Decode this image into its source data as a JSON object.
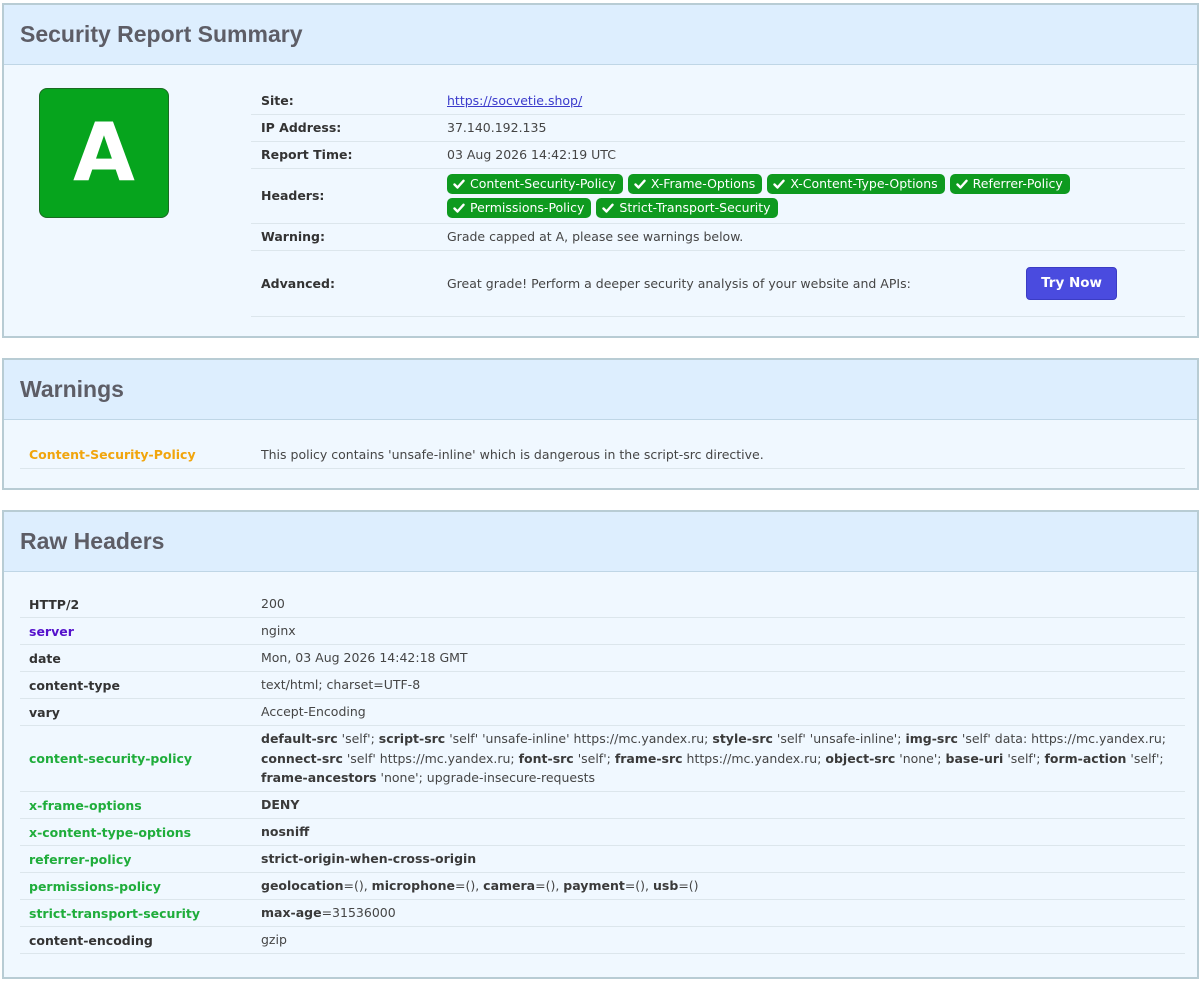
{
  "summary": {
    "title": "Security Report Summary",
    "grade": "A",
    "grade_color": "#06a41d",
    "rows": {
      "site_label": "Site:",
      "site_value": "https://socvetie.shop/",
      "ip_label": "IP Address:",
      "ip_value": "37.140.192.135",
      "time_label": "Report Time:",
      "time_value": "03 Aug 2026 14:42:19 UTC",
      "headers_label": "Headers:",
      "headers": [
        "Content-Security-Policy",
        "X-Frame-Options",
        "X-Content-Type-Options",
        "Referrer-Policy",
        "Permissions-Policy",
        "Strict-Transport-Security"
      ],
      "warning_label": "Warning:",
      "warning_value": "Grade capped at A, please see warnings below.",
      "advanced_label": "Advanced:",
      "advanced_value": "Great grade! Perform a deeper security analysis of your website and APIs:",
      "try_now": "Try Now"
    }
  },
  "warnings": {
    "title": "Warnings",
    "items": [
      {
        "name": "Content-Security-Policy",
        "text": "This policy contains 'unsafe-inline' which is dangerous in the script-src directive."
      }
    ]
  },
  "raw": {
    "title": "Raw Headers",
    "rows": [
      {
        "k": "HTTP/2",
        "v": "200"
      },
      {
        "k": "server",
        "v": "nginx"
      },
      {
        "k": "date",
        "v": "Mon, 03 Aug 2026 14:42:18 GMT"
      },
      {
        "k": "content-type",
        "v": "text/html; charset=UTF-8"
      },
      {
        "k": "vary",
        "v": "Accept-Encoding"
      },
      {
        "k": "content-security-policy",
        "csp": [
          {
            "d": "default-src",
            "v": " 'self'; "
          },
          {
            "d": "script-src",
            "v": " 'self' 'unsafe-inline' https://mc.yandex.ru; "
          },
          {
            "d": "style-src",
            "v": " 'self' 'unsafe-inline'; "
          },
          {
            "d": "img-src",
            "v": " 'self' data: https://mc.yandex.ru; "
          },
          {
            "d": "connect-src",
            "v": " 'self' https://mc.yandex.ru; "
          },
          {
            "d": "font-src",
            "v": " 'self'; "
          },
          {
            "d": "frame-src",
            "v": " https://mc.yandex.ru; "
          },
          {
            "d": "object-src",
            "v": " 'none'; "
          },
          {
            "d": "base-uri",
            "v": " 'self'; "
          },
          {
            "d": "form-action",
            "v": " 'self'; "
          },
          {
            "d": "frame-ancestors",
            "v": " 'none'; upgrade-insecure-requests"
          }
        ]
      },
      {
        "k": "x-frame-options",
        "v": "DENY"
      },
      {
        "k": "x-content-type-options",
        "v": "nosniff"
      },
      {
        "k": "referrer-policy",
        "v": "strict-origin-when-cross-origin"
      },
      {
        "k": "permissions-policy",
        "pp": [
          {
            "d": "geolocation",
            "v": "=(), "
          },
          {
            "d": "microphone",
            "v": "=(), "
          },
          {
            "d": "camera",
            "v": "=(), "
          },
          {
            "d": "payment",
            "v": "=(), "
          },
          {
            "d": "usb",
            "v": "=()"
          }
        ]
      },
      {
        "k": "strict-transport-security",
        "hsts": {
          "d": "max-age",
          "v": "=31536000"
        }
      },
      {
        "k": "content-encoding",
        "v": "gzip"
      }
    ]
  }
}
